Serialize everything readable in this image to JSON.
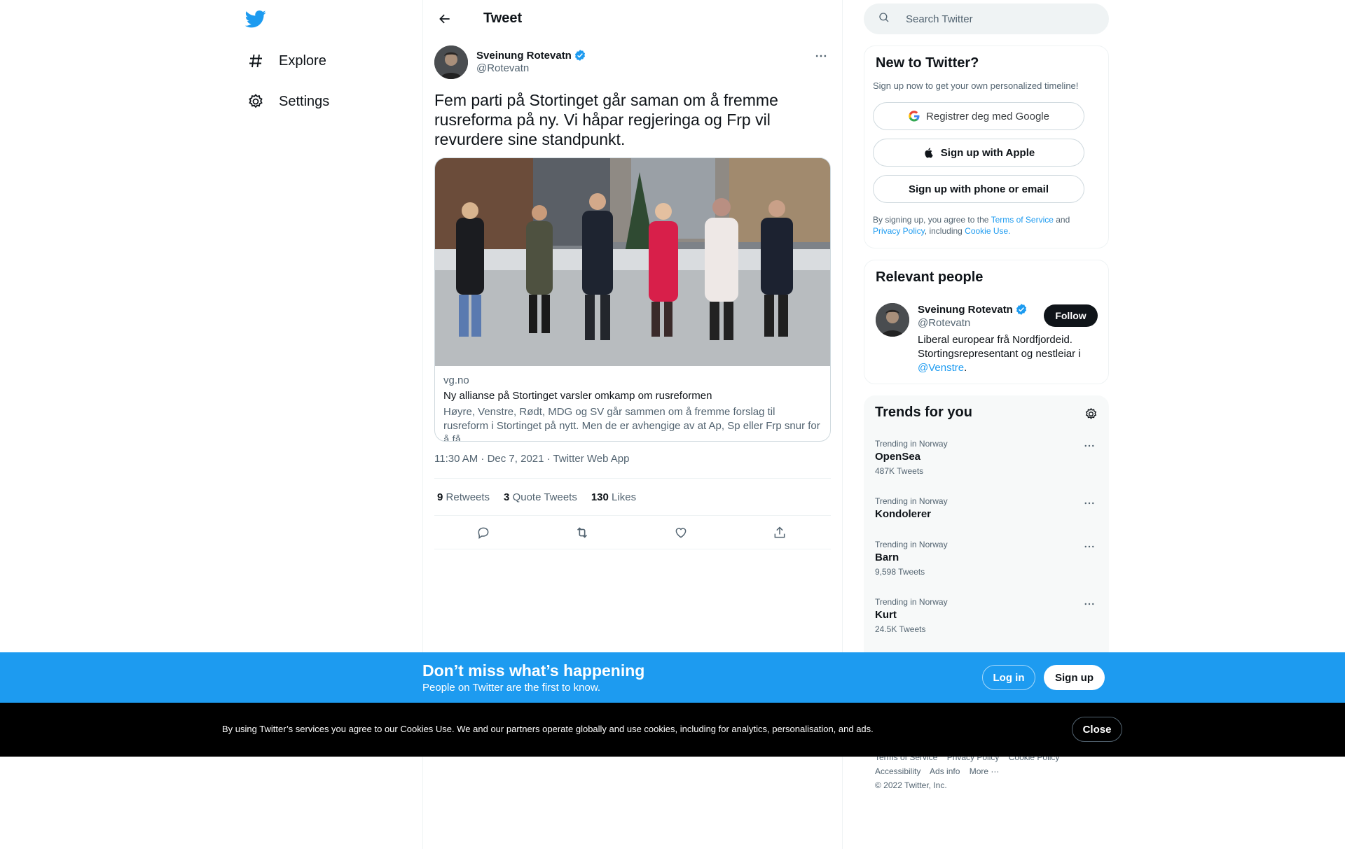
{
  "nav": {
    "logo": "twitter-bird-icon",
    "items": [
      {
        "label": "Explore",
        "icon": "hashtag-icon"
      },
      {
        "label": "Settings",
        "icon": "gear-icon"
      }
    ]
  },
  "header": {
    "title": "Tweet"
  },
  "tweet": {
    "author_name": "Sveinung Rotevatn",
    "author_handle": "@Rotevatn",
    "text": "Fem parti på Stortinget går saman om å fremme rusreforma på ny. Vi håpar regjeringa og Frp vil revurdere sine standpunkt.",
    "card": {
      "domain": "vg.no",
      "title": "Ny allianse på Stortinget varsler omkamp om rusreformen",
      "description": "Høyre, Venstre, Rødt, MDG og SV går sammen om å fremme forslag til rusreform i Stortinget på nytt. Men de er avhengige av at Ap, Sp eller Frp snur for å få …"
    },
    "timestamp": "11:30 AM · Dec 7, 2021 · Twitter Web App",
    "stats": {
      "retweets_count": "9",
      "retweets_label": "Retweets",
      "quotes_count": "3",
      "quotes_label": "Quote Tweets",
      "likes_count": "130",
      "likes_label": "Likes"
    }
  },
  "search": {
    "placeholder": "Search Twitter"
  },
  "new_to_twitter": {
    "title": "New to Twitter?",
    "subtitle": "Sign up now to get your own personalized timeline!",
    "google_label": "Registrer deg med Google",
    "apple_label": "Sign up with Apple",
    "phone_label": "Sign up with phone or email",
    "terms_prefix": "By signing up, you agree to the ",
    "terms_link": "Terms of Service",
    "terms_and": " and ",
    "privacy_link": "Privacy Policy",
    "terms_including": ", including ",
    "cookie_link": "Cookie Use",
    "terms_end": "."
  },
  "relevant_people": {
    "title": "Relevant people",
    "name": "Sveinung Rotevatn",
    "handle": "@Rotevatn",
    "follow_label": "Follow",
    "bio": "Liberal europear frå Nordfjordeid. Stortingsrepresentant og nestleiar i ",
    "bio_link": "@Venstre",
    "bio_end": "."
  },
  "trends": {
    "title": "Trends for you",
    "items": [
      {
        "context": "Trending in Norway",
        "name": "OpenSea",
        "count": "487K Tweets"
      },
      {
        "context": "Trending in Norway",
        "name": "Kondolerer",
        "count": ""
      },
      {
        "context": "Trending in Norway",
        "name": "Barn",
        "count": "9,598 Tweets"
      },
      {
        "context": "Trending in Norway",
        "name": "Kurt",
        "count": "24.5K Tweets"
      }
    ]
  },
  "footer": {
    "terms": "Terms of Service",
    "privacy": "Privacy Policy",
    "cookie": "Cookie Policy",
    "accessibility": "Accessibility",
    "ads": "Ads info",
    "more": "More ···",
    "copyright": "© 2022 Twitter, Inc."
  },
  "banner": {
    "title": "Don’t miss what’s happening",
    "subtitle": "People on Twitter are the first to know.",
    "login": "Log in",
    "signup": "Sign up"
  },
  "cookie_bar": {
    "text": "By using Twitter’s services you agree to our Cookies Use. We and our partners operate globally and use cookies, including for analytics, personalisation, and ads.",
    "close": "Close"
  },
  "colors": {
    "accent": "#1d9bf0",
    "text": "#0f1419",
    "secondary": "#536471"
  }
}
